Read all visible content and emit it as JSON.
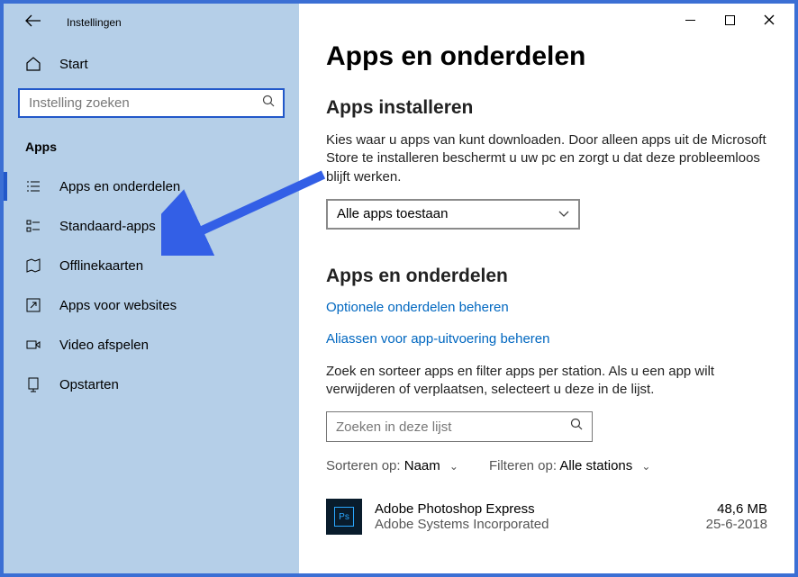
{
  "window": {
    "title": "Instellingen"
  },
  "sidebar": {
    "start": "Start",
    "search_placeholder": "Instelling zoeken",
    "category": "Apps",
    "items": [
      {
        "label": "Apps en onderdelen"
      },
      {
        "label": "Standaard-apps"
      },
      {
        "label": "Offlinekaarten"
      },
      {
        "label": "Apps voor websites"
      },
      {
        "label": "Video afspelen"
      },
      {
        "label": "Opstarten"
      }
    ]
  },
  "main": {
    "h1": "Apps en onderdelen",
    "install": {
      "heading": "Apps installeren",
      "desc": "Kies waar u apps van kunt downloaden. Door alleen apps uit de Microsoft Store te installeren beschermt u uw pc en zorgt u dat deze probleemloos blijft werken.",
      "dropdown": "Alle apps toestaan"
    },
    "section": {
      "heading": "Apps en onderdelen",
      "link1": "Optionele onderdelen beheren",
      "link2": "Aliassen voor app-uitvoering beheren",
      "desc": "Zoek en sorteer apps en filter apps per station. Als u een app wilt verwijderen of verplaatsen, selecteert u deze in de lijst.",
      "search_placeholder": "Zoeken in deze lijst",
      "sort_label": "Sorteren op:",
      "sort_value": "Naam",
      "filter_label": "Filteren op:",
      "filter_value": "Alle stations"
    },
    "apps": [
      {
        "name": "Adobe Photoshop Express",
        "publisher": "Adobe Systems Incorporated",
        "size": "48,6 MB",
        "date": "25-6-2018",
        "icon_text": "Ps"
      }
    ]
  }
}
